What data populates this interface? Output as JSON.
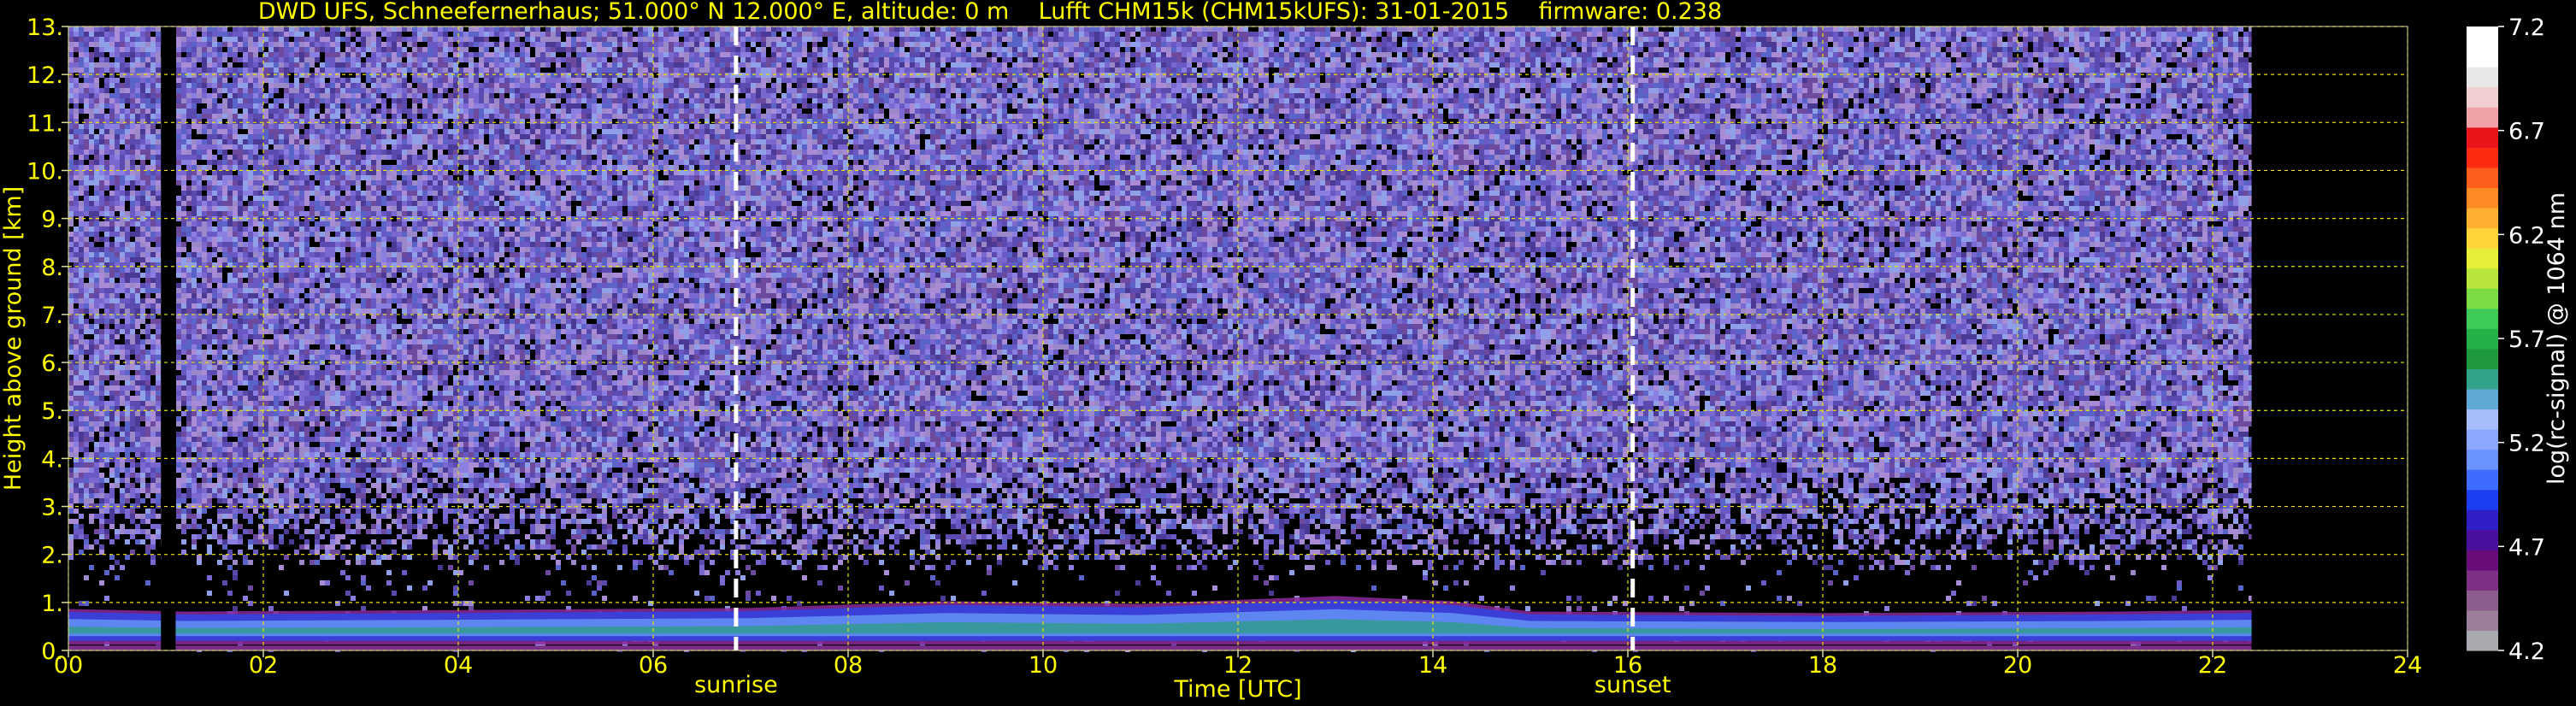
{
  "chart_data": {
    "type": "heatmap",
    "title": "DWD UFS, Schneefernerhaus; 51.000° N 12.000° E, altitude: 0 m    Lufft CHM15k (CHM15kUFS): 31-01-2015    firmware: 0.238",
    "xlabel": "Time [UTC]",
    "ylabel": "Height above ground [km]",
    "xlim": [
      0,
      24
    ],
    "ylim": [
      0,
      13
    ],
    "xticks": [
      "00",
      "02",
      "04",
      "06",
      "08",
      "10",
      "12",
      "14",
      "16",
      "18",
      "20",
      "22",
      "24"
    ],
    "yticks": [
      "0.",
      "1.",
      "2.",
      "3.",
      "4.",
      "5.",
      "6.",
      "7.",
      "8.",
      "9.",
      "10.",
      "11.",
      "12.",
      "13."
    ],
    "grid": true,
    "data_end_hour": 22.4,
    "data_gap_hours": [
      0.95,
      1.1
    ],
    "markers": [
      {
        "label": "sunrise",
        "hour": 6.85
      },
      {
        "label": "sunset",
        "hour": 16.05
      }
    ],
    "boundary_layer": [
      {
        "hour": 0.0,
        "top_km": 0.8
      },
      {
        "hour": 1.2,
        "top_km": 0.75
      },
      {
        "hour": 4.0,
        "top_km": 0.78
      },
      {
        "hour": 7.0,
        "top_km": 0.82
      },
      {
        "hour": 9.0,
        "top_km": 0.95
      },
      {
        "hour": 11.0,
        "top_km": 0.9
      },
      {
        "hour": 13.0,
        "top_km": 1.05
      },
      {
        "hour": 14.2,
        "top_km": 0.95
      },
      {
        "hour": 15.0,
        "top_km": 0.75
      },
      {
        "hour": 18.0,
        "top_km": 0.72
      },
      {
        "hour": 21.0,
        "top_km": 0.75
      },
      {
        "hour": 22.4,
        "top_km": 0.78
      }
    ],
    "colorbar": {
      "label": "log(rc-signal) @ 1064 nm",
      "min": 4.2,
      "max": 7.2,
      "ticks": [
        "4.2",
        "4.7",
        "5.2",
        "5.7",
        "6.2",
        "6.7",
        "7.2"
      ],
      "colors": [
        "#a9a9b0",
        "#9b7f9a",
        "#8d5c8f",
        "#7e2f86",
        "#6b0c7b",
        "#4b0f9e",
        "#2f1fc4",
        "#1c3ef0",
        "#3f6cff",
        "#6a93ff",
        "#8aa8ff",
        "#a6bdfb",
        "#5fa9d7",
        "#31a38a",
        "#1e9a3c",
        "#26b04a",
        "#3ecb55",
        "#7bdc44",
        "#b8e53b",
        "#e6ee38",
        "#ffd33a",
        "#ffb030",
        "#ff8a24",
        "#ff5d1b",
        "#ff2a12",
        "#e8141a",
        "#f0a2a8",
        "#f1cfd1",
        "#e7e7e7",
        "#ffffff",
        "#ffffff"
      ]
    }
  },
  "colors": {
    "text": "#ffff00",
    "grid": "#e6e600",
    "marker": "#ffffff",
    "background_signal": "#5a4aa8",
    "colorbar_text": "#ffffff"
  }
}
